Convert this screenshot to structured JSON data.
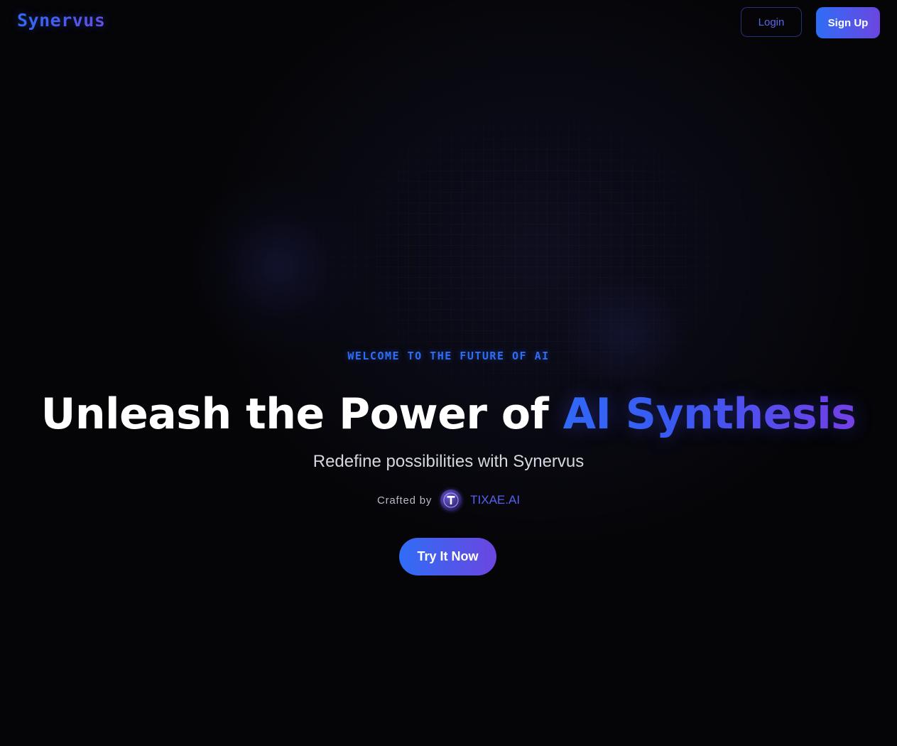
{
  "header": {
    "logo": "Synervus",
    "login_label": "Login",
    "signup_label": "Sign Up"
  },
  "hero": {
    "eyebrow": "WELCOME TO THE FUTURE OF AI",
    "headline_plain": "Unleash the Power of ",
    "headline_accent": "AI Synthesis",
    "subtitle": "Redefine possibilities with Synervus",
    "crafted_label": "Crafted by",
    "crafted_brand": "TIXAE.AI",
    "cta_label": "Try It Now"
  },
  "icons": {
    "brand_avatar": "tixae-logo-icon"
  },
  "colors": {
    "background": "#050508",
    "accent_blue": "#2f6df6",
    "accent_purple": "#6b46e0",
    "text_primary": "#ffffff",
    "text_secondary": "#d6d6e0"
  }
}
